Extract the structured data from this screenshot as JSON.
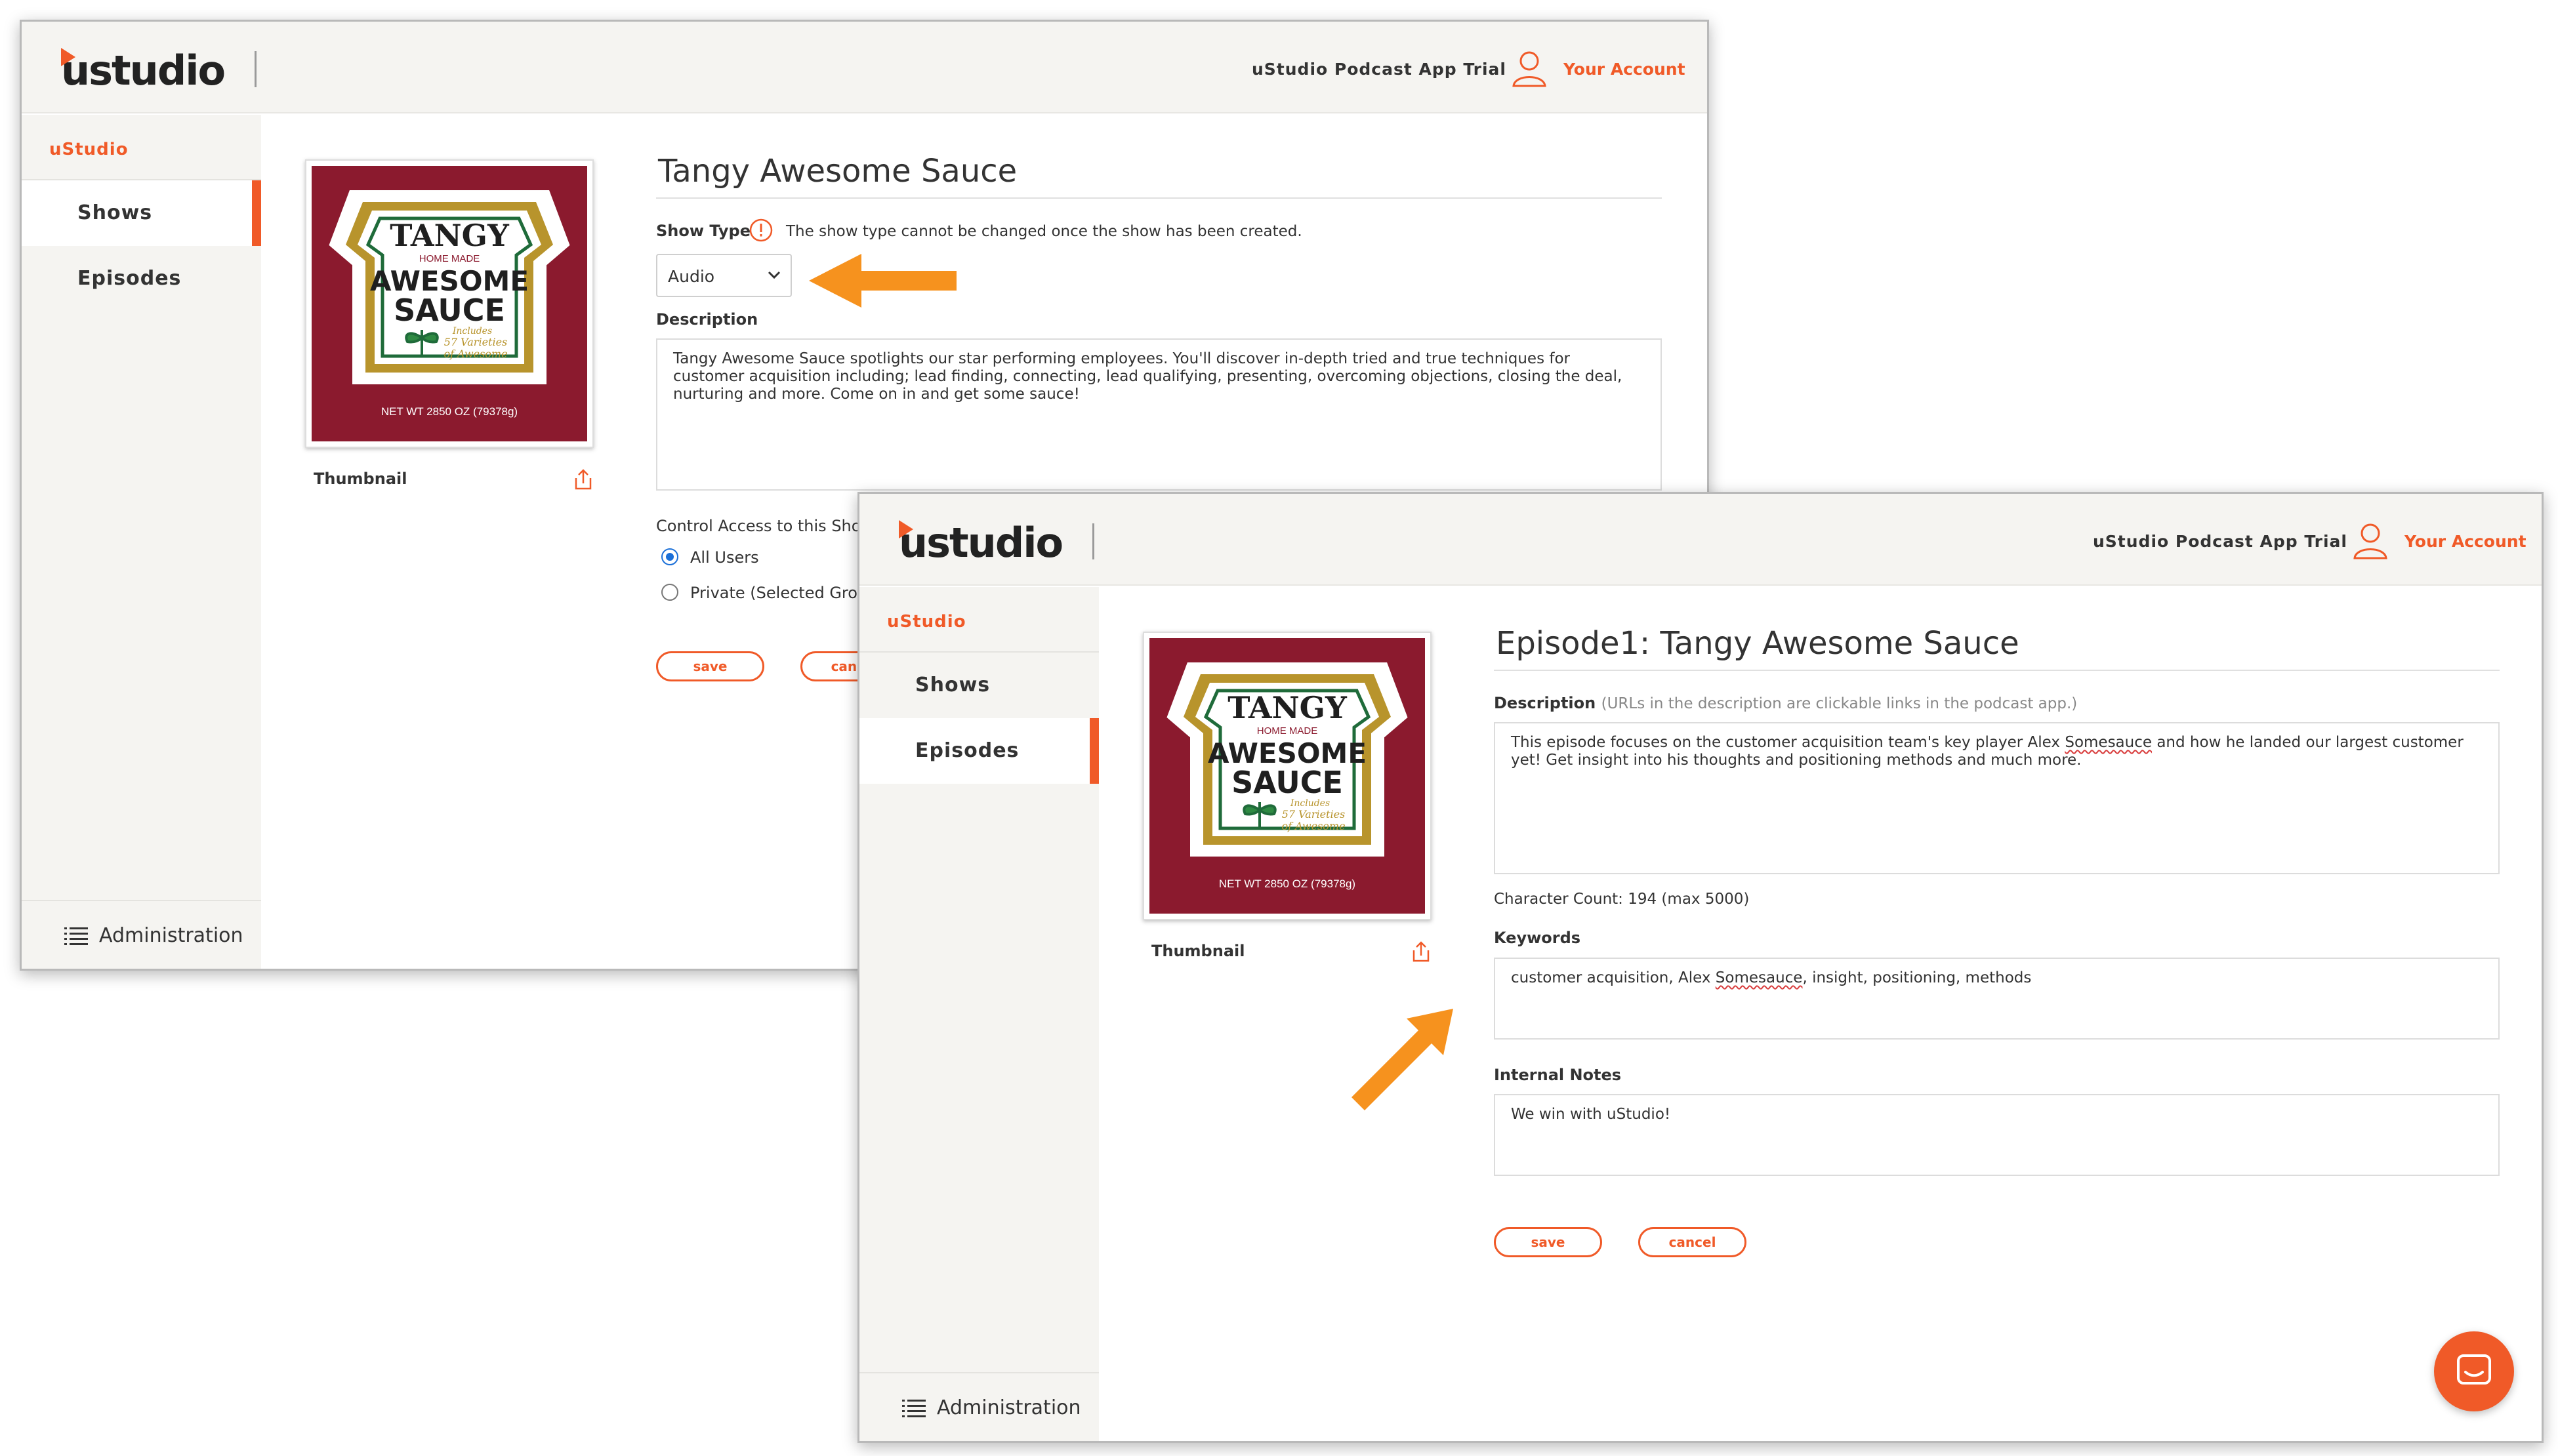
{
  "brand": {
    "logo": "ustudio",
    "accent": "#f05a28"
  },
  "header": {
    "app_name": "uStudio Podcast App Trial",
    "account_label": "Your Account"
  },
  "sidebar": {
    "brand_label": "uStudio",
    "items": [
      {
        "label": "Shows"
      },
      {
        "label": "Episodes"
      }
    ],
    "admin_label": "Administration"
  },
  "thumbnail": {
    "label": "Thumbnail",
    "art": {
      "line1": "TANGY",
      "line2": "HOME MADE",
      "line3": "AWESOME",
      "line4": "SAUCE",
      "line5": "Includes",
      "line6": "57 Varieties",
      "line7": "of Awesome",
      "line8": "NET WT 2850 OZ (79378g)"
    }
  },
  "show_form": {
    "title": "Tangy Awesome Sauce",
    "show_type_label": "Show Type",
    "show_type_hint": "The show type cannot be changed once the show has been created.",
    "show_type_value": "Audio",
    "description_label": "Description",
    "description": "Tangy Awesome Sauce spotlights our star performing employees. You'll discover in-depth tried and true techniques for customer acquisition including; lead finding, connecting, lead qualifying, presenting, overcoming objections, closing the deal, nurturing and more. Come on in and get some sauce!",
    "access_label": "Control Access to this Show",
    "access_options": [
      {
        "label": "All Users",
        "selected": true
      },
      {
        "label": "Private (Selected Groups)",
        "selected": false
      }
    ],
    "save_label": "save",
    "cancel_label": "cancel"
  },
  "episode_form": {
    "title": "Episode1: Tangy Awesome Sauce",
    "description_label": "Description",
    "description_hint": "(URLs in the description are clickable links in the podcast app.)",
    "description_part1": "This episode focuses on the customer acquisition team's key player Alex ",
    "description_name": "Somesauce",
    "description_part2": " and how he landed our largest customer yet! Get insight into his thoughts and positioning methods and much more.",
    "char_count": "Character Count: 194 (max 5000)",
    "keywords_label": "Keywords",
    "keywords_part1": "customer acquisition, Alex ",
    "keywords_name": "Somesauce",
    "keywords_part2": ", insight, positioning, methods",
    "notes_label": "Internal Notes",
    "notes": "We win with uStudio!",
    "save_label": "save",
    "cancel_label": "cancel"
  }
}
